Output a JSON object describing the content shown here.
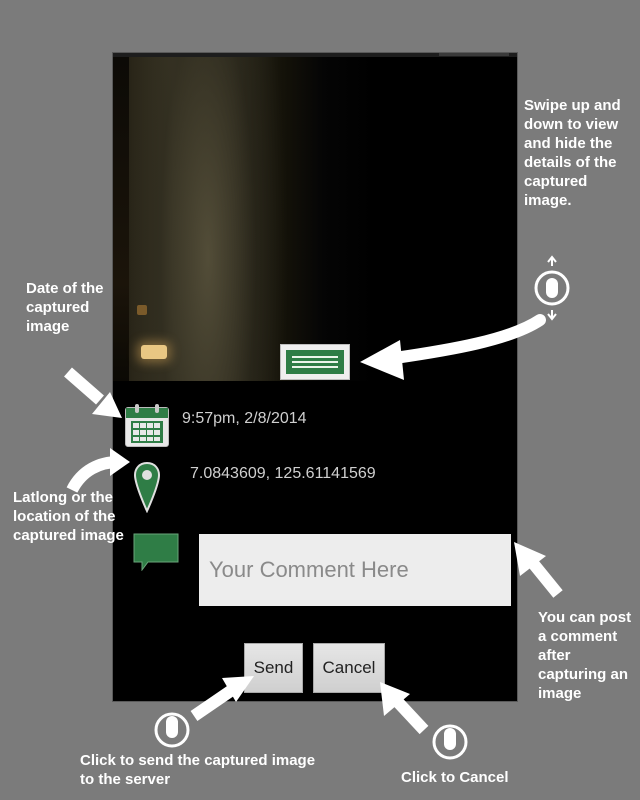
{
  "capture": {
    "date_text": "9:57pm, 2/8/2014",
    "latlong_text": "7.0843609, 125.61141569"
  },
  "comment": {
    "placeholder": "Your Comment Here"
  },
  "buttons": {
    "send_label": "Send",
    "cancel_label": "Cancel"
  },
  "annotations": {
    "swipe": "Swipe up and down to view and hide the details of the captured image.",
    "date": "Date of the captured image",
    "latlong": "Latlong or the location of the captured image",
    "comment": "You can post a comment after capturing an image",
    "send": "Click to send the captured image to the server",
    "cancel": "Click to Cancel"
  },
  "icons": [
    "calendar-icon",
    "location-pin-icon",
    "comment-bubble-icon",
    "swipe-gesture-icon",
    "tap-gesture-icon"
  ],
  "colors": {
    "background": "#7b7b7b",
    "accent_green": "#2f7d46",
    "screen": "#000000",
    "button": "#dcdcdc"
  }
}
